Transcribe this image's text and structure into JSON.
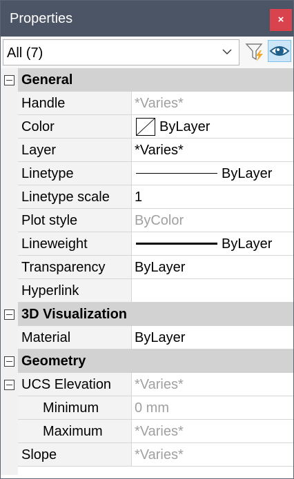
{
  "window": {
    "title": "Properties",
    "close_glyph": "×"
  },
  "toolbar": {
    "selection": "All (7)",
    "icons": [
      "chevron-down-icon",
      "quick-select-filter-icon",
      "eye-icon"
    ]
  },
  "colors": {
    "titlebar": "#4b5565",
    "close": "#d9434e",
    "category": "#d2d2d2",
    "inactive_value": "#a0a0a0",
    "toggle_active": "#cde6f7"
  },
  "categories": {
    "general": {
      "label": "General",
      "rows": {
        "handle": {
          "name": "Handle",
          "value": "*Varies*"
        },
        "color": {
          "name": "Color",
          "value": "ByLayer"
        },
        "layer": {
          "name": "Layer",
          "value": "*Varies*"
        },
        "linetype": {
          "name": "Linetype",
          "value": "ByLayer"
        },
        "linetype_scale": {
          "name": "Linetype scale",
          "value": "1"
        },
        "plot_style": {
          "name": "Plot style",
          "value": "ByColor"
        },
        "lineweight": {
          "name": "Lineweight",
          "value": "ByLayer"
        },
        "transparency": {
          "name": "Transparency",
          "value": "ByLayer"
        },
        "hyperlink": {
          "name": "Hyperlink",
          "value": ""
        }
      }
    },
    "visualization": {
      "label": "3D Visualization",
      "rows": {
        "material": {
          "name": "Material",
          "value": "ByLayer"
        }
      }
    },
    "geometry": {
      "label": "Geometry",
      "rows": {
        "ucs_elevation": {
          "name": "UCS Elevation",
          "value": "*Varies*"
        },
        "minimum": {
          "name": "Minimum",
          "value": "0 mm"
        },
        "maximum": {
          "name": "Maximum",
          "value": "*Varies*"
        },
        "slope": {
          "name": "Slope",
          "value": "*Varies*"
        }
      }
    }
  }
}
